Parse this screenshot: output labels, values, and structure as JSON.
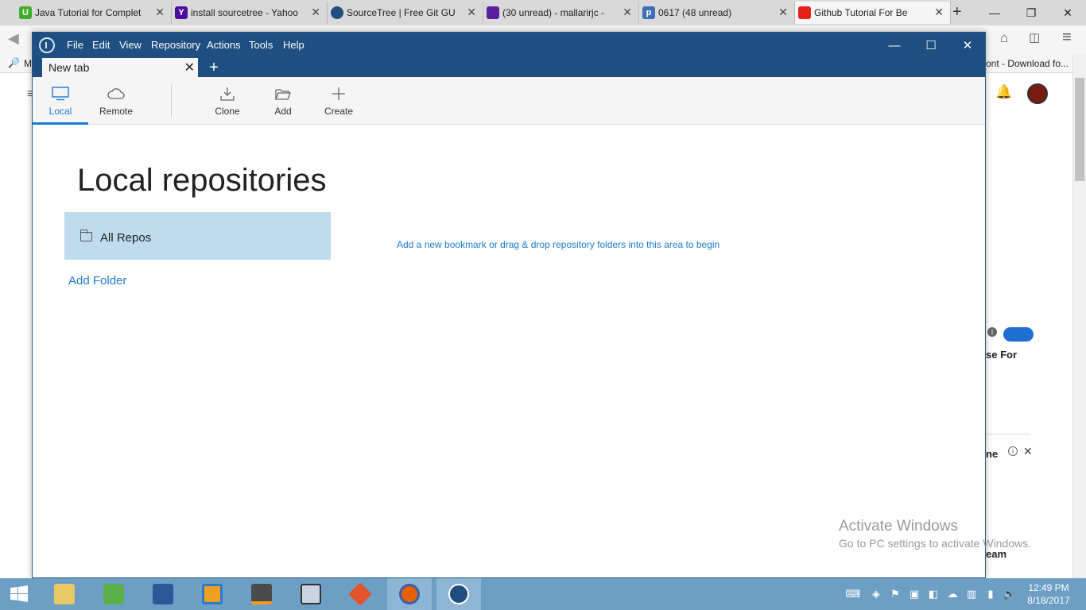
{
  "browser": {
    "tabs": [
      {
        "title": "Java Tutorial for Complet",
        "favicon": "U",
        "color": "#3fae2a"
      },
      {
        "title": "install sourcetree - Yahoo",
        "favicon": "Y",
        "color": "#4b0fa0"
      },
      {
        "title": "SourceTree | Free Git GUI",
        "favicon": "",
        "color": "#205081"
      },
      {
        "title": "(30 unread) - mallarirjc - ",
        "favicon": "",
        "color": "#5a1f9a"
      },
      {
        "title": "0617 (48 unread)",
        "favicon": "p",
        "color": "#3b6fb6"
      },
      {
        "title": "Github Tutorial For Be",
        "favicon": "",
        "color": "#e62117"
      }
    ],
    "bookmark_prefix": "M",
    "bookmark_right": "ont - Download fo...",
    "page_snippets": {
      "text1": "se For",
      "text2": "ne",
      "text3": "eam"
    }
  },
  "sourcetree": {
    "menu": [
      "File",
      "Edit",
      "View",
      "Repository",
      "Actions",
      "Tools",
      "Help"
    ],
    "tab_label": "New tab",
    "toolbar": {
      "local": "Local",
      "remote": "Remote",
      "clone": "Clone",
      "add": "Add",
      "create": "Create"
    },
    "page_title": "Local repositories",
    "repo_group": "All Repos",
    "add_folder": "Add Folder",
    "hint": "Add a new bookmark or drag & drop repository folders into this area to begin"
  },
  "watermark": {
    "line1": "Activate Windows",
    "line2": "Go to PC settings to activate Windows."
  },
  "taskbar": {
    "time": "12:49 PM",
    "date": "8/18/2017"
  },
  "colors": {
    "titlebar": "#1f4e80",
    "accent": "#1e7bd0",
    "repo_group_bg": "#bfdcee",
    "taskbar": "#6d9ec4"
  }
}
